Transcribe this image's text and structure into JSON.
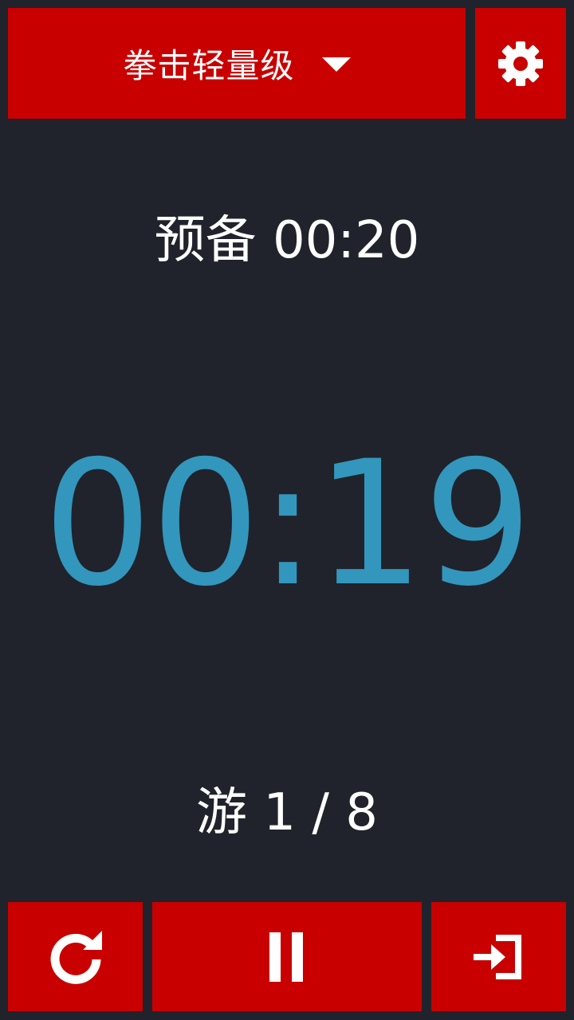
{
  "header": {
    "mode_label": "拳击轻量级",
    "dropdown_icon": "caret-down-icon",
    "settings_icon": "gear-icon"
  },
  "status": {
    "prep_text": "预备 00:20",
    "timer": "00:19",
    "round_text": "游 1 / 8"
  },
  "controls": {
    "reset_icon": "refresh-icon",
    "pause_icon": "pause-icon",
    "exit_icon": "sign-in-icon"
  },
  "colors": {
    "background": "#20232b",
    "button_red": "#c80000",
    "timer_blue": "#3396bd",
    "text_white": "#ffffff"
  }
}
